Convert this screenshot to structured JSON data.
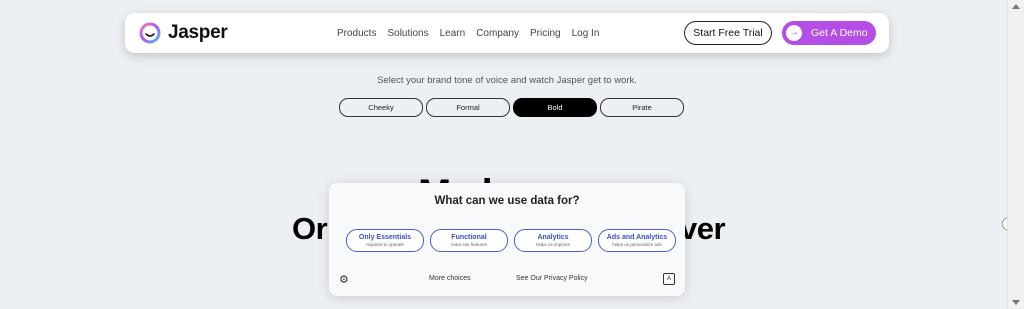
{
  "brand": {
    "name": "Jasper",
    "accent": "#b44ee6"
  },
  "nav": {
    "links": [
      "Products",
      "Solutions",
      "Learn",
      "Company",
      "Pricing",
      "Log In"
    ],
    "trial_label": "Start Free Trial",
    "demo_label": "Get A Demo",
    "demo_icon": "arrow-right-icon"
  },
  "hero": {
    "tagline": "Select your brand tone of voice and watch Jasper get to work.",
    "tones": [
      "Cheeky",
      "Formal",
      "Bold",
      "Pirate"
    ],
    "active_tone": "Bold",
    "heading_top": "Ma   h",
    "heading_left": "Or",
    "heading_right": "ver"
  },
  "consent": {
    "title": "What can we use data for?",
    "options": [
      {
        "label": "Only Essentials",
        "sub": "required to operate"
      },
      {
        "label": "Functional",
        "sub": "extra site features"
      },
      {
        "label": "Analytics",
        "sub": "helps us improve"
      },
      {
        "label": "Ads and Analytics",
        "sub": "helps us personalize ads"
      }
    ],
    "more_choices": "More choices",
    "privacy": "See Our Privacy Policy",
    "settings_icon": "gear-icon",
    "translate_icon": "translate-icon"
  },
  "widget_icon": "plus-icon"
}
